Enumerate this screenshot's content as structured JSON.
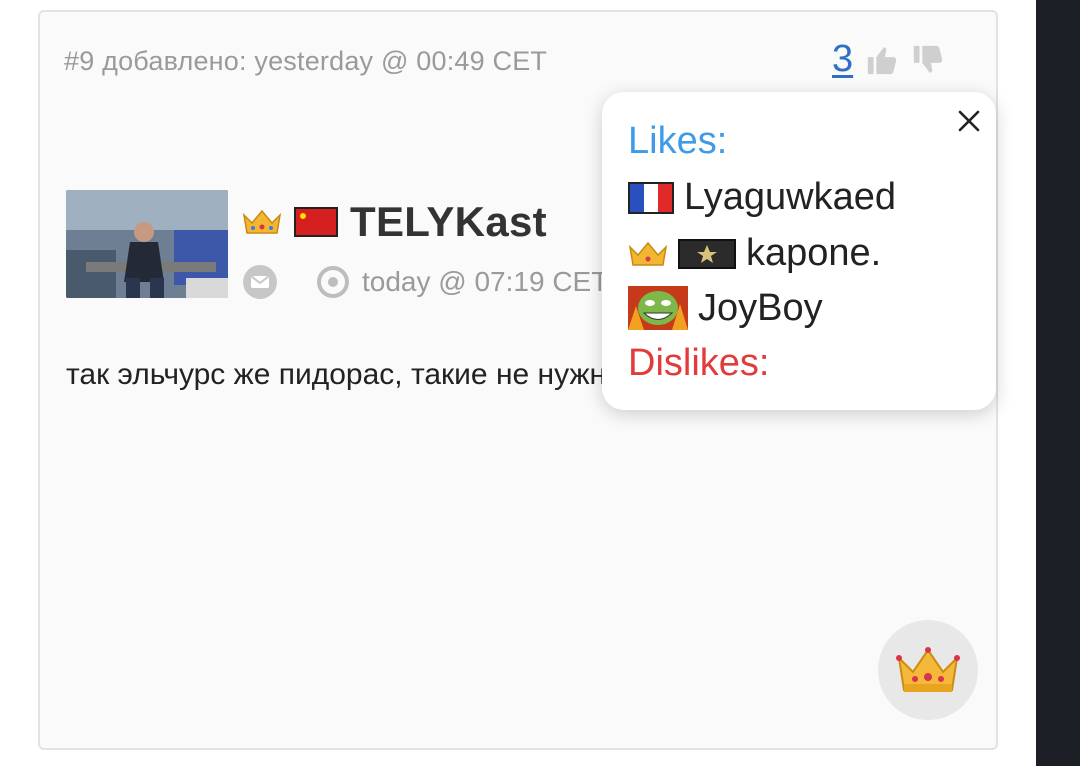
{
  "post": {
    "meta": "#9 добавлено: yesterday @ 00:49 CET",
    "rating_count": "3",
    "author": {
      "name": "TELYKast",
      "last_seen": "today @ 07:19 CET"
    },
    "text": "так эльчурс же пидорас, такие не нужны"
  },
  "likes_popup": {
    "likes_title": "Likes:",
    "dislikes_title": "Dislikes:",
    "likers": [
      {
        "name": "Lyaguwkaed",
        "badges": [
          "flag-france"
        ]
      },
      {
        "name": "kapone.",
        "badges": [
          "crown",
          "rank-badge"
        ]
      },
      {
        "name": "JoyBoy",
        "badges": [
          "troll-face-avatar"
        ]
      }
    ]
  },
  "icons": {
    "thumb_up": "thumbs-up-icon",
    "thumb_down": "thumbs-down-icon",
    "mail": "mail-icon",
    "clock": "clock-icon",
    "close": "close-icon",
    "crown": "crown-icon"
  },
  "colors": {
    "likes": "#3d9be9",
    "dislikes": "#e23b3b",
    "rating_link": "#2f6fc5",
    "meta_text": "#9a9a9a"
  }
}
